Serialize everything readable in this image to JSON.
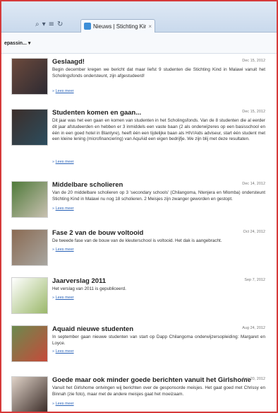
{
  "browser": {
    "address_controls": [
      "⌕",
      "▾",
      "≡",
      "↻"
    ],
    "tab": {
      "title": "Nieuws | Stichting Kind in ...",
      "close": "×",
      "icon": "page-favicon-icon"
    },
    "toolbar_menu": "epassin... ▾"
  },
  "news": [
    {
      "title": "Geslaagd!",
      "date": "Dec 15, 2012",
      "text": "Begin december kregen we bericht dat maar liefst 9 studenten die Stichting Kind in Malawi vanuit het Scholingsfonds ondersteunt, zijn afgestudeerd!",
      "more": "Lees meer",
      "thumb_colors": [
        "#6c4a3c",
        "#2d2a32"
      ]
    },
    {
      "title": "Studenten komen en gaan...",
      "date": "Dec 15, 2012",
      "text": "Dit jaar was het een gaan en komen van studenten in het Scholingsfonds. Van de 8 studenten die al eerder dit jaar afstudeerden en hebben er 3 inmiddels een vaste baan (2 als onderwijzeres op een basisschool en één in een goed hotel in Blantyre), heeft één een tijdelijke baan als HIV/Aids adviseur, start één student met een kleine lening (microfinanciering) van AquAid een eigen bedrijfje. We zijn blij met deze resultaten.",
      "more": "Lees meer",
      "thumb_colors": [
        "#3c2e2a",
        "#2c4d5e"
      ]
    },
    {
      "title": "Middelbare scholieren",
      "date": "Dec 14, 2012",
      "text": "Van de 20 middelbare scholieren op 3 'secondary schools' (Chilangoma, Ntenjera en Mlomba) ondersteunt Stichting Kind in Malawi nu nog 18 scholieren. 2 Meisjes zijn zwanger geworden en gestopt.",
      "more": "Lees meer",
      "thumb_colors": [
        "#4f7a3a",
        "#c8c0b0"
      ]
    },
    {
      "title": "Fase 2 van de bouw voltooid",
      "date": "Oct 24, 2012",
      "text": "De tweede fase van de bouw van de kleuterschool is voltooid. Het dak is aangebracht.",
      "more": "Lees meer",
      "thumb_colors": [
        "#8a6a52",
        "#a8a6a0"
      ]
    },
    {
      "title": "Jaarverslag 2011",
      "date": "Sep 7, 2012",
      "text": "Het verslag van 2011 is gepubliceerd.",
      "more": "Lees meer",
      "thumb_colors": [
        "#ffffff",
        "#9bb86a"
      ]
    },
    {
      "title": "Aquaid nieuwe studenten",
      "date": "Aug 24, 2012",
      "text": "In september gaan nieuwe studenten van start op Dapp Chilangoma onderwijzersopleiding: Margaret en Loyce.",
      "more": "Lees meer",
      "thumb_colors": [
        "#6b8a4e",
        "#c64a3a"
      ]
    },
    {
      "title": "Goede maar ook minder goede berichten vanuit het Girlshome",
      "date": "Aug 20, 2012",
      "text": "Vanuit het Girlshome ontvingen wij berichten over de gesponsorde meisjes. Het gaat goed met Chrissy en Binnah (zie foto), maar met de andere meisjes gaat het moeizaam.",
      "more": "Lees meer",
      "thumb_colors": [
        "#e0d3c8",
        "#3a2c28"
      ]
    }
  ]
}
